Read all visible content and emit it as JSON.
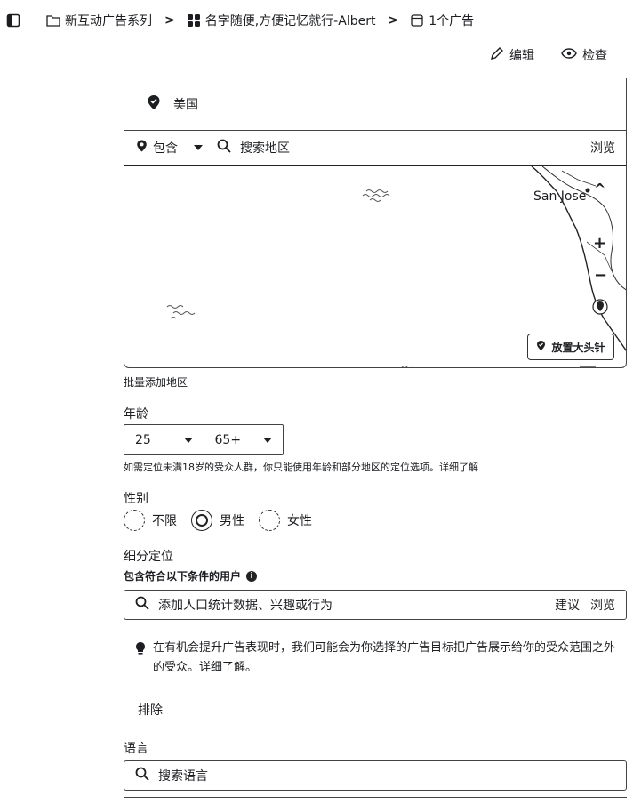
{
  "breadcrumb": {
    "items": [
      {
        "label": "新互动广告系列",
        "icon": "folder-icon"
      },
      {
        "label": "名字随便,方便记忆就行-Albert",
        "icon": "grid-icon"
      },
      {
        "label": "1个广告",
        "icon": "ad-icon"
      }
    ],
    "separator": ">"
  },
  "actions": {
    "edit": "编辑",
    "inspect": "检查"
  },
  "location": {
    "selected": "美国",
    "include_label": "包含",
    "search_placeholder": "搜索地区",
    "browse": "浏览"
  },
  "map": {
    "city_label": "San Jose",
    "drop_pin": "放置大头针",
    "zoom_in": "+",
    "zoom_out": "−",
    "collapse": "^"
  },
  "bulk_add": "批量添加地区",
  "age": {
    "title": "年龄",
    "min": "25",
    "max": "65+",
    "note": "如需定位未满18岁的受众人群，你只能使用年龄和部分地区的定位选项。详细了解"
  },
  "gender": {
    "title": "性别",
    "options": [
      "不限",
      "男性",
      "女性"
    ],
    "selected": "男性"
  },
  "detailed": {
    "title": "细分定位",
    "subtitle": "包含符合以下条件的用户",
    "placeholder": "添加人口统计数据、兴趣或行为",
    "suggest": "建议",
    "browse": "浏览",
    "tip": "在有机会提升广告表现时，我们可能会为你选择的广告目标把广告展示给你的受众范围之外的受众。详细了解。",
    "exclude": "排除"
  },
  "language": {
    "title": "语言",
    "placeholder": "搜索语言"
  }
}
